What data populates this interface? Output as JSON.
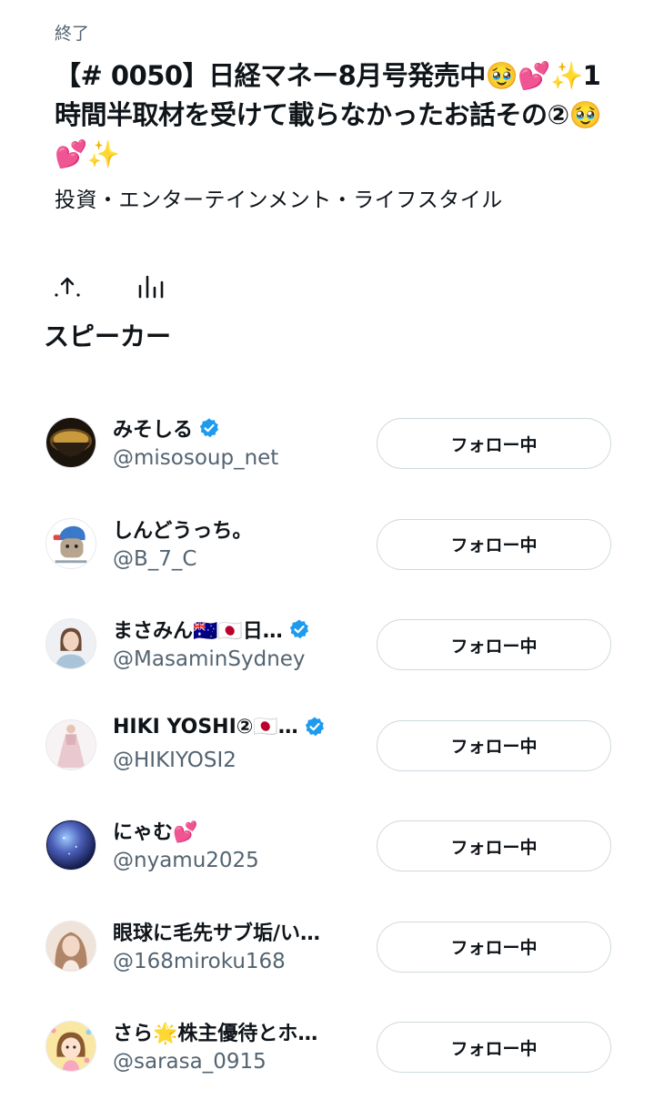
{
  "header": {
    "status": "終了",
    "title": "【# 0050】日経マネー8月号発売中🥹💕✨1時間半取材を受けて載らなかったお話その②🥹💕✨",
    "topics": "投資・エンターテインメント・ライフスタイル",
    "share_icon": "share-icon",
    "stats_icon": "stats-icon"
  },
  "speakers": {
    "section_title": "スピーカー",
    "items": [
      {
        "name": "みそしる",
        "handle": "@misosoup_net",
        "verified": true,
        "button": "フォロー中",
        "avatar_color": "#2b2418"
      },
      {
        "name": "しんどうっち。",
        "handle": "@B_7_C",
        "verified": false,
        "button": "フォロー中",
        "avatar_color": "#3a78c9"
      },
      {
        "name": "まさみん🇦🇺🇯🇵日…",
        "handle": "@MasaminSydney",
        "verified": true,
        "button": "フォロー中",
        "avatar_color": "#d9dde3"
      },
      {
        "name": "HIKI YOSHI②🇯🇵…",
        "handle": "@HIKIYOSI2",
        "verified": true,
        "button": "フォロー中",
        "avatar_color": "#e9c9cf"
      },
      {
        "name": "にゃむ💕",
        "handle": "@nyamu2025",
        "verified": false,
        "button": "フォロー中",
        "avatar_color": "#1b2d6b"
      },
      {
        "name": "眼球に毛先サブ垢/い…",
        "handle": "@168miroku168",
        "verified": false,
        "button": "フォロー中",
        "avatar_color": "#c9a58a"
      },
      {
        "name": "さら🌟株主優待とホ…",
        "handle": "@sarasa_0915",
        "verified": false,
        "button": "フォロー中",
        "avatar_color": "#f2c94c"
      }
    ]
  },
  "colors": {
    "text_primary": "#0f1419",
    "text_secondary": "#536471",
    "verified_blue": "#1d9bf0",
    "button_border": "#cfd9de"
  }
}
